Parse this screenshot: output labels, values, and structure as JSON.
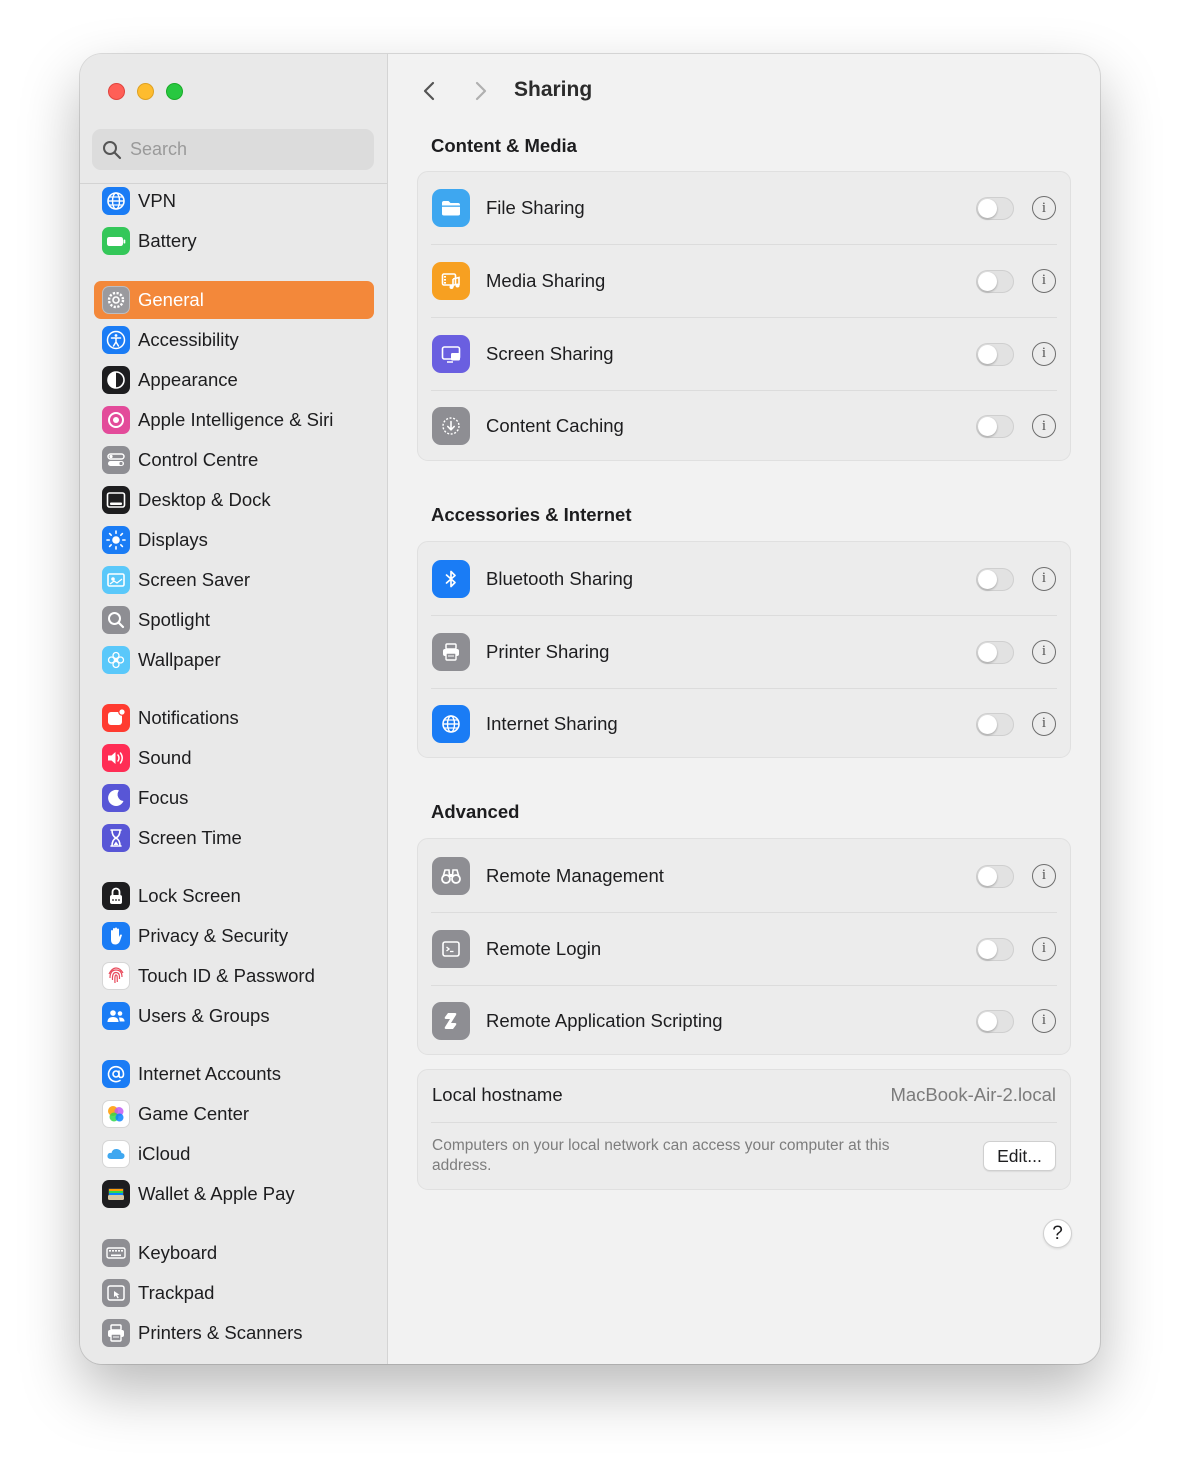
{
  "window": {
    "title": "Sharing"
  },
  "search": {
    "placeholder": "Search"
  },
  "sidebar": {
    "items": [
      {
        "label": "VPN",
        "icon": "globe-icon",
        "color": "#1a7cf5"
      },
      {
        "label": "Battery",
        "icon": "battery-icon",
        "color": "#34c759"
      },
      {
        "label": "General",
        "icon": "gear-icon",
        "color": "#8e8e93",
        "selected": true
      },
      {
        "label": "Accessibility",
        "icon": "accessibility-icon",
        "color": "#1a7cf5"
      },
      {
        "label": "Appearance",
        "icon": "appearance-icon",
        "color": "#1d1d1f"
      },
      {
        "label": "Apple Intelligence & Siri",
        "icon": "siri-icon",
        "color": "#e34b9a"
      },
      {
        "label": "Control Centre",
        "icon": "control-centre-icon",
        "color": "#8e8e93"
      },
      {
        "label": "Desktop & Dock",
        "icon": "dock-icon",
        "color": "#1d1d1f"
      },
      {
        "label": "Displays",
        "icon": "sun-icon",
        "color": "#1a7cf5"
      },
      {
        "label": "Screen Saver",
        "icon": "screen-saver-icon",
        "color": "#5ac8fa"
      },
      {
        "label": "Spotlight",
        "icon": "magnifier-icon",
        "color": "#8e8e93"
      },
      {
        "label": "Wallpaper",
        "icon": "flower-icon",
        "color": "#5ac8fa"
      },
      {
        "label": "Notifications",
        "icon": "bell-icon",
        "color": "#ff3b30"
      },
      {
        "label": "Sound",
        "icon": "speaker-icon",
        "color": "#ff2d55"
      },
      {
        "label": "Focus",
        "icon": "moon-icon",
        "color": "#5856d6"
      },
      {
        "label": "Screen Time",
        "icon": "hourglass-icon",
        "color": "#5856d6"
      },
      {
        "label": "Lock Screen",
        "icon": "lock-icon",
        "color": "#1d1d1f"
      },
      {
        "label": "Privacy & Security",
        "icon": "hand-icon",
        "color": "#1a7cf5"
      },
      {
        "label": "Touch ID & Password",
        "icon": "fingerprint-icon",
        "color": "#ffffff"
      },
      {
        "label": "Users & Groups",
        "icon": "users-icon",
        "color": "#1a7cf5"
      },
      {
        "label": "Internet Accounts",
        "icon": "at-icon",
        "color": "#1a7cf5"
      },
      {
        "label": "Game Center",
        "icon": "game-center-icon",
        "color": "#ffffff"
      },
      {
        "label": "iCloud",
        "icon": "cloud-icon",
        "color": "#ffffff"
      },
      {
        "label": "Wallet & Apple Pay",
        "icon": "wallet-icon",
        "color": "#1d1d1f"
      },
      {
        "label": "Keyboard",
        "icon": "keyboard-icon",
        "color": "#8e8e93"
      },
      {
        "label": "Trackpad",
        "icon": "trackpad-icon",
        "color": "#8e8e93"
      },
      {
        "label": "Printers & Scanners",
        "icon": "printer-icon",
        "color": "#8e8e93"
      }
    ]
  },
  "main": {
    "sections": [
      {
        "title": "Content & Media",
        "rows": [
          {
            "label": "File Sharing",
            "icon": "folder-icon",
            "color": "#3ea7f0",
            "enabled": false
          },
          {
            "label": "Media Sharing",
            "icon": "media-icon",
            "color": "#f7a021",
            "enabled": false
          },
          {
            "label": "Screen Sharing",
            "icon": "screen-sharing-icon",
            "color": "#6a5fe0",
            "enabled": false
          },
          {
            "label": "Content Caching",
            "icon": "download-icon",
            "color": "#8e8e93",
            "enabled": false
          }
        ]
      },
      {
        "title": "Accessories & Internet",
        "rows": [
          {
            "label": "Bluetooth Sharing",
            "icon": "bluetooth-icon",
            "color": "#1a7cf5",
            "enabled": false
          },
          {
            "label": "Printer Sharing",
            "icon": "printer-icon",
            "color": "#8e8e93",
            "enabled": false
          },
          {
            "label": "Internet Sharing",
            "icon": "globe-icon",
            "color": "#1a7cf5",
            "enabled": false
          }
        ]
      },
      {
        "title": "Advanced",
        "rows": [
          {
            "label": "Remote Management",
            "icon": "binoculars-icon",
            "color": "#8e8e93",
            "enabled": false
          },
          {
            "label": "Remote Login",
            "icon": "terminal-icon",
            "color": "#8e8e93",
            "enabled": false
          },
          {
            "label": "Remote Application Scripting",
            "icon": "script-icon",
            "color": "#8e8e93",
            "enabled": false
          }
        ]
      }
    ],
    "hostname": {
      "label": "Local hostname",
      "value": "MacBook-Air-2.local",
      "description": "Computers on your local network can access your computer at this address.",
      "edit_label": "Edit..."
    },
    "help_label": "?"
  }
}
